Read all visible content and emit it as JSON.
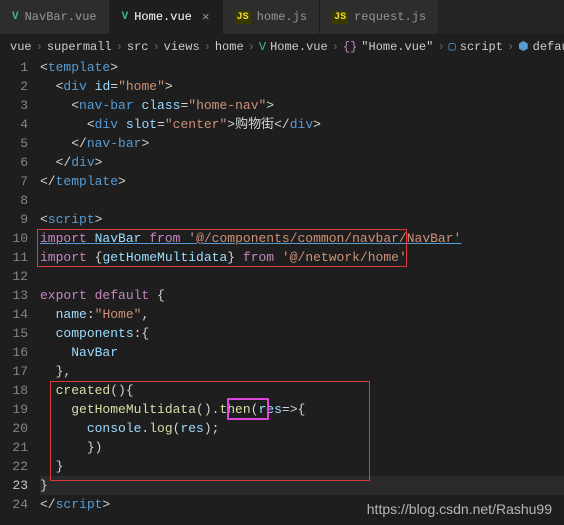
{
  "tabs": [
    {
      "icon": "V",
      "label": "NavBar.vue",
      "active": false,
      "close": ""
    },
    {
      "icon": "V",
      "label": "Home.vue",
      "active": true,
      "close": "×"
    },
    {
      "icon": "JS",
      "label": "home.js",
      "active": false,
      "close": ""
    },
    {
      "icon": "JS",
      "label": "request.js",
      "active": false,
      "close": ""
    }
  ],
  "breadcrumb": {
    "parts": [
      "vue",
      "supermall",
      "src",
      "views",
      "home",
      "Home.vue",
      "\"Home.vue\"",
      "script",
      "defau"
    ],
    "sep": "›"
  },
  "lines": {
    "l1": "1",
    "l2": "2",
    "l3": "3",
    "l4": "4",
    "l5": "5",
    "l6": "6",
    "l7": "7",
    "l8": "8",
    "l9": "9",
    "l10": "10",
    "l11": "11",
    "l12": "12",
    "l13": "13",
    "l14": "14",
    "l15": "15",
    "l16": "16",
    "l17": "17",
    "l18": "18",
    "l19": "19",
    "l20": "20",
    "l21": "21",
    "l22": "22",
    "l23": "23",
    "l24": "24"
  },
  "code": {
    "template_open": "template",
    "div": "div",
    "id": "id",
    "home": "\"home\"",
    "navbar": "nav-bar",
    "class": "class",
    "homenav": "\"home-nav\"",
    "slot": "slot",
    "center": "\"center\"",
    "shop": "购物街",
    "script": "script",
    "import": "import",
    "NavBar": "NavBar",
    "from": "from",
    "navpath": "'@/components/common/navbar/NavBar'",
    "getHomeMultidata": "getHomeMultidata",
    "homepath": "'@/network/home'",
    "export": "export",
    "default": "default",
    "name": "name",
    "Home": "\"Home\"",
    "components": "components",
    "created": "created",
    "then": "then",
    "res": "res",
    "console": "console",
    "log": "log"
  },
  "watermark": "https://blog.csdn.net/Rashu99"
}
